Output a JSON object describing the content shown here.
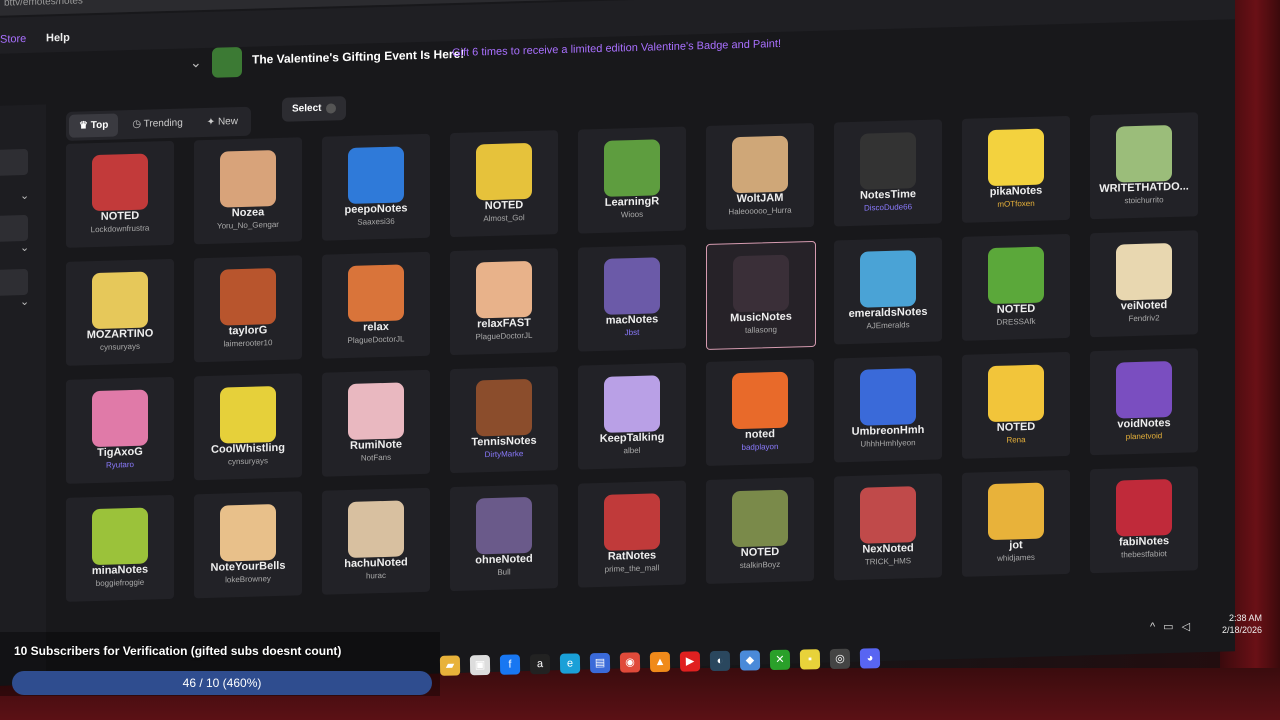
{
  "browser": {
    "url_fragment": "bttv/emotes/notes"
  },
  "nav": {
    "store": "Store",
    "help": "Help"
  },
  "banner": {
    "title": "The Valentine's Gifting Event Is Here!",
    "message": "Gift 6 times to receive a limited edition Valentine's Badge and Paint!"
  },
  "filters": {
    "top": "Top",
    "trending": "Trending",
    "new": "New",
    "select": "Select"
  },
  "emotes": [
    {
      "name": "NOTED",
      "author": "Lockdownfrustra",
      "color": "#c23a3a"
    },
    {
      "name": "Nozea",
      "author": "Yoru_No_Gengar",
      "color": "#d8a37a"
    },
    {
      "name": "peepoNotes",
      "author": "Saaxesi36",
      "color": "#2f7ad9"
    },
    {
      "name": "NOTED",
      "author": "Almost_Gol",
      "color": "#e6c23b"
    },
    {
      "name": "LearningR",
      "author": "Wioos",
      "color": "#5e9d3f"
    },
    {
      "name": "WoltJAM",
      "author": "Haleooooo_Hurra",
      "color": "#cfa778"
    },
    {
      "name": "NotesTime",
      "author": "DiscoDude66",
      "color": "#333",
      "author_style": "purple"
    },
    {
      "name": "pikaNotes",
      "author": "mOTfoxen",
      "color": "#f3d23e",
      "author_style": "gold"
    },
    {
      "name": "WRITETHATDO...",
      "author": "stoichurrito",
      "color": "#9bbd7a"
    },
    {
      "name": "MOZARTINO",
      "author": "cynsuryays",
      "color": "#e6c85a"
    },
    {
      "name": "taylorG",
      "author": "laimerooter10",
      "color": "#b8552d"
    },
    {
      "name": "relax",
      "author": "PlagueDoctorJL",
      "color": "#d9743a"
    },
    {
      "name": "relaxFAST",
      "author": "PlagueDoctorJL",
      "color": "#e8b28a"
    },
    {
      "name": "macNotes",
      "author": "Jbst",
      "color": "#6b5aa8",
      "author_style": "purple"
    },
    {
      "name": "MusicNotes",
      "author": "tallasong",
      "color": "#3a2f38"
    },
    {
      "name": "emeraldsNotes",
      "author": "AJEmeralds",
      "color": "#4aa3d6"
    },
    {
      "name": "NOTED",
      "author": "DRESSAfk",
      "color": "#5ba83a"
    },
    {
      "name": "veiNoted",
      "author": "Fendriv2",
      "color": "#e8d7b0"
    },
    {
      "name": "TigAxoG",
      "author": "Ryutaro",
      "color": "#e07aa8",
      "author_style": "purple"
    },
    {
      "name": "CoolWhistling",
      "author": "cynsuryays",
      "color": "#e6d03a"
    },
    {
      "name": "RumiNote",
      "author": "NotFans",
      "color": "#e9b8c0"
    },
    {
      "name": "TennisNotes",
      "author": "DirtyMarke",
      "color": "#8b4d2c",
      "author_style": "purple"
    },
    {
      "name": "KeepTalking",
      "author": "albel",
      "color": "#b9a0e6"
    },
    {
      "name": "noted",
      "author": "badplayon",
      "color": "#e86a2a",
      "author_style": "purple"
    },
    {
      "name": "UmbreonHmh",
      "author": "UhhhHmhlyeon",
      "color": "#3a6ad9"
    },
    {
      "name": "NOTED",
      "author": "Rena",
      "color": "#f2c53a",
      "author_style": "gold"
    },
    {
      "name": "voidNotes",
      "author": "planetvoid",
      "color": "#7a4ec0",
      "author_style": "gold"
    },
    {
      "name": "minaNotes",
      "author": "boggiefroggie",
      "color": "#9bc23a"
    },
    {
      "name": "NoteYourBells",
      "author": "lokeBrowney",
      "color": "#e8c08a"
    },
    {
      "name": "hachuNoted",
      "author": "hurac",
      "color": "#d8c0a0"
    },
    {
      "name": "ohneNoted",
      "author": "Bull",
      "color": "#6a5a8a"
    },
    {
      "name": "RatNotes",
      "author": "prime_the_mall",
      "color": "#c03a3a"
    },
    {
      "name": "NOTED",
      "author": "stalkinBoyz",
      "color": "#7a8a4a"
    },
    {
      "name": "NexNoted",
      "author": "TRICK_HMS",
      "color": "#c04a4a"
    },
    {
      "name": "jot",
      "author": "whidjames",
      "color": "#e8b23a"
    },
    {
      "name": "fabiNotes",
      "author": "thebestfabiot",
      "color": "#c02a3a"
    }
  ],
  "taskbar": {
    "icons": [
      "folder-icon",
      "store-icon",
      "facebook-icon",
      "amazon-icon",
      "edge-icon",
      "notes-icon",
      "chrome-icon",
      "vlc-icon",
      "youtube-icon",
      "steam-icon",
      "app-icon",
      "xbox-icon",
      "sticky-icon",
      "obs-icon",
      "discord-icon"
    ]
  },
  "clock": {
    "time": "2:38 AM",
    "date": "2/18/2026"
  },
  "subscriber_goal": {
    "label": "10 Subscribers for Verification (gifted subs doesnt count)",
    "progress_text": "46 / 10 (460%)",
    "current": 46,
    "target": 10
  }
}
